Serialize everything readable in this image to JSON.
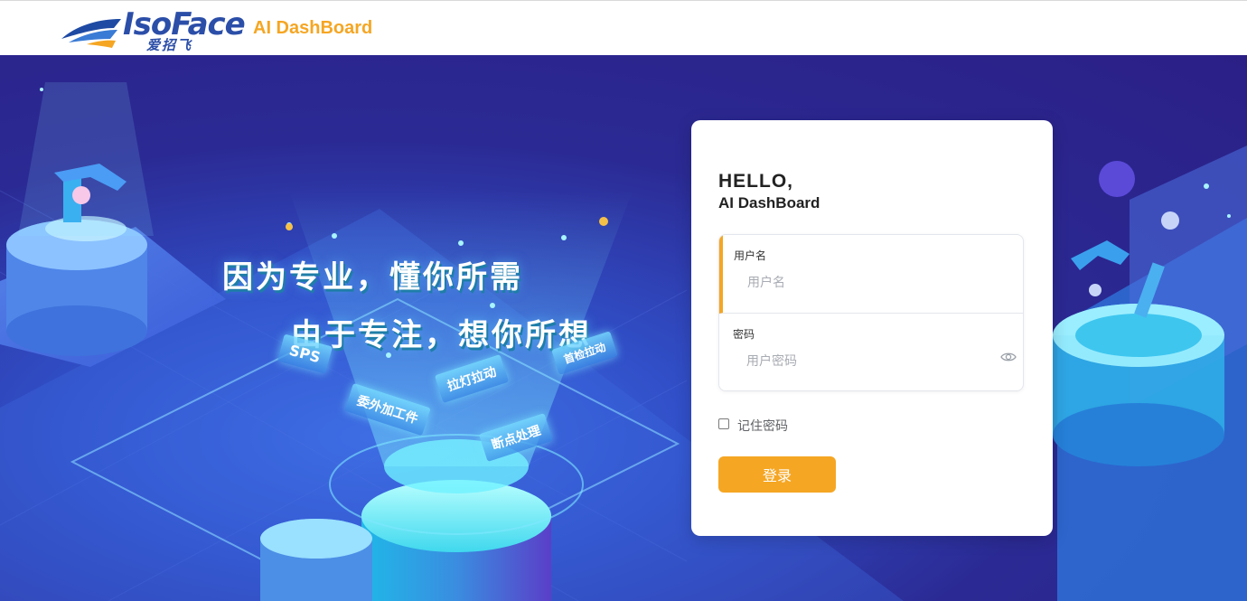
{
  "header": {
    "logo_word": "IsoFace",
    "logo_cn": "爱招飞",
    "app_title": "AI DashBoard"
  },
  "hero": {
    "slogan_line1": "因为专业，懂你所需",
    "slogan_line2": "由于专注，想你所想",
    "tags": {
      "sps": "SPS",
      "pull": "拉灯拉动",
      "outsource": "委外加工件",
      "breakpoint": "断点处理",
      "inspection": "首检拉动"
    }
  },
  "login": {
    "hello": "HELLO,",
    "subtitle": "AI DashBoard",
    "username_label": "用户名",
    "username_placeholder": "用户名",
    "password_label": "密码",
    "password_placeholder": "用户密码",
    "remember_label": "记住密码",
    "remember_checked": false,
    "login_button": "登录",
    "accent_color": "#f5a623"
  }
}
